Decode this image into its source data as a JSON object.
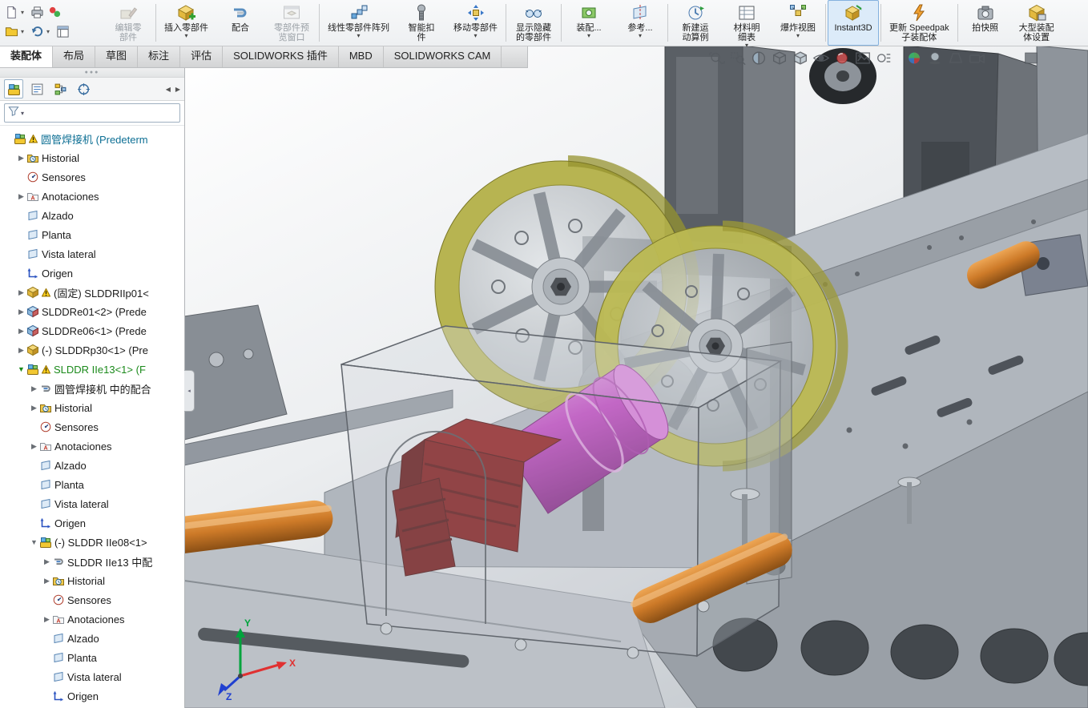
{
  "app": {
    "name": "SOLIDWORKS",
    "document": "圆管焊接机"
  },
  "colors": {
    "accent": "#2d7dc4",
    "selected-green": "#1b8a1b",
    "root-blue": "#0d6f94",
    "olive": "#b3b048",
    "olive-bright": "#bcb952",
    "magenta": "#c143c1",
    "dark-red": "#7d1212",
    "orange": "#cd7a28"
  },
  "quick_access": {
    "row1": [
      {
        "id": "new-document",
        "caret": true
      },
      {
        "id": "print",
        "caret": false
      },
      {
        "id": "performance",
        "caret": false
      }
    ],
    "row2": [
      {
        "id": "open-document",
        "caret": true
      },
      {
        "id": "undo",
        "caret": true
      },
      {
        "id": "task-list",
        "caret": false
      }
    ]
  },
  "command_manager": {
    "buttons": [
      {
        "id": "edit-component",
        "lines": [
          "编辑零",
          "部件"
        ],
        "disabled": true
      },
      {
        "sep": true
      },
      {
        "id": "insert-component",
        "lines": [
          "插入零部件"
        ],
        "dropdown": true
      },
      {
        "id": "mate",
        "lines": [
          "配合"
        ]
      },
      {
        "id": "component-preview",
        "lines": [
          "零部件预",
          "览窗口"
        ],
        "disabled": true
      },
      {
        "sep": true
      },
      {
        "id": "linear-pattern",
        "lines": [
          "线性零部件阵列"
        ],
        "dropdown": true
      },
      {
        "id": "smart-fastener",
        "lines": [
          "智能扣",
          "件"
        ]
      },
      {
        "id": "move-component",
        "lines": [
          "移动零部件"
        ],
        "dropdown": true
      },
      {
        "sep": true
      },
      {
        "id": "show-hidden",
        "lines": [
          "显示隐藏",
          "的零部件"
        ]
      },
      {
        "sep": true
      },
      {
        "id": "assembly-features",
        "lines": [
          "装配..."
        ],
        "dropdown": true
      },
      {
        "id": "reference",
        "lines": [
          "参考..."
        ],
        "dropdown": true
      },
      {
        "sep": true
      },
      {
        "id": "motion-study",
        "lines": [
          "新建运",
          "动算例"
        ]
      },
      {
        "id": "bom",
        "lines": [
          "材料明",
          "细表"
        ],
        "dropdown": true
      },
      {
        "id": "exploded-view",
        "lines": [
          "爆炸视图"
        ],
        "dropdown": true
      },
      {
        "sep": true
      },
      {
        "id": "instant3d",
        "lines": [
          "Instant3D"
        ],
        "active": true
      },
      {
        "sep": true
      },
      {
        "id": "speedpak",
        "lines": [
          "更新 Speedpak",
          "子装配体"
        ]
      },
      {
        "sep": true
      },
      {
        "id": "snapshot",
        "lines": [
          "拍快照"
        ]
      },
      {
        "id": "large-assembly",
        "lines": [
          "大型装配",
          "体设置"
        ]
      }
    ]
  },
  "tabs": [
    {
      "label": "装配体",
      "active": true
    },
    {
      "label": "布局"
    },
    {
      "label": "草图"
    },
    {
      "label": "标注"
    },
    {
      "label": "评估"
    },
    {
      "label": "SOLIDWORKS 插件"
    },
    {
      "label": "MBD"
    },
    {
      "label": "SOLIDWORKS CAM"
    }
  ],
  "feature_panel": {
    "manager_tabs": [
      "featuremanager",
      "propertymanager",
      "configurationmanager",
      "dimxpertmanager"
    ],
    "nav_left": "◀",
    "nav_right": "▶",
    "filter": {
      "value": ""
    },
    "tree": [
      {
        "level": 0,
        "arrow": "",
        "icon": "asm",
        "warn": true,
        "label": "圆管焊接机 (Predeterm",
        "cls": "root"
      },
      {
        "level": 1,
        "arrow": "r",
        "icon": "hist",
        "label": "Historial"
      },
      {
        "level": 1,
        "arrow": "",
        "icon": "sens",
        "label": "Sensores"
      },
      {
        "level": 1,
        "arrow": "r",
        "icon": "anno",
        "label": "Anotaciones"
      },
      {
        "level": 1,
        "arrow": "",
        "icon": "plane",
        "label": "Alzado"
      },
      {
        "level": 1,
        "arrow": "",
        "icon": "plane",
        "label": "Planta"
      },
      {
        "level": 1,
        "arrow": "",
        "icon": "plane",
        "label": "Vista lateral"
      },
      {
        "level": 1,
        "arrow": "",
        "icon": "orig",
        "label": "Origen"
      },
      {
        "level": 1,
        "arrow": "r",
        "icon": "part",
        "warn": true,
        "label": "(固定) SLDDRIIp01<"
      },
      {
        "level": 1,
        "arrow": "r",
        "icon": "part2",
        "label": "SLDDRe01<2> (Prede"
      },
      {
        "level": 1,
        "arrow": "r",
        "icon": "part2",
        "label": "SLDDRe06<1> (Prede"
      },
      {
        "level": 1,
        "arrow": "r",
        "icon": "part",
        "label": "(-) SLDDRp30<1> (Pre"
      },
      {
        "level": 1,
        "arrow": "d",
        "icon": "asm",
        "warn": true,
        "label": "SLDDR IIe13<1> (F",
        "cls": "selected"
      },
      {
        "level": 2,
        "arrow": "r",
        "icon": "mate",
        "label": "圆管焊接机 中的配合"
      },
      {
        "level": 2,
        "arrow": "r",
        "icon": "hist",
        "label": "Historial"
      },
      {
        "level": 2,
        "arrow": "",
        "icon": "sens",
        "label": "Sensores"
      },
      {
        "level": 2,
        "arrow": "r",
        "icon": "anno",
        "label": "Anotaciones"
      },
      {
        "level": 2,
        "arrow": "",
        "icon": "plane",
        "label": "Alzado"
      },
      {
        "level": 2,
        "arrow": "",
        "icon": "plane",
        "label": "Planta"
      },
      {
        "level": 2,
        "arrow": "",
        "icon": "plane",
        "label": "Vista lateral"
      },
      {
        "level": 2,
        "arrow": "",
        "icon": "orig",
        "label": "Origen"
      },
      {
        "level": 2,
        "arrow": "d",
        "icon": "asm",
        "label": "(-) SLDDR IIe08<1>"
      },
      {
        "level": 3,
        "arrow": "r",
        "icon": "mate",
        "label": "SLDDR IIe13 中配"
      },
      {
        "level": 3,
        "arrow": "r",
        "icon": "hist",
        "label": "Historial"
      },
      {
        "level": 3,
        "arrow": "",
        "icon": "sens",
        "label": "Sensores"
      },
      {
        "level": 3,
        "arrow": "r",
        "icon": "anno",
        "label": "Anotaciones"
      },
      {
        "level": 3,
        "arrow": "",
        "icon": "plane",
        "label": "Alzado"
      },
      {
        "level": 3,
        "arrow": "",
        "icon": "plane",
        "label": "Planta"
      },
      {
        "level": 3,
        "arrow": "",
        "icon": "plane",
        "label": "Vista lateral"
      },
      {
        "level": 3,
        "arrow": "",
        "icon": "orig",
        "label": "Origen"
      }
    ]
  },
  "viewport": {
    "heads_up": {
      "group1": [
        "zoom-fit",
        "zoom-area",
        "section-view",
        "view-orientation",
        "display-style",
        "hide-show-items",
        "edit-appearance",
        "apply-scene",
        "view-settings"
      ],
      "group2": [
        "realview",
        "shadows",
        "perspective",
        "camera"
      ],
      "group3": [
        "display-pane"
      ]
    },
    "triad": {
      "x": "X",
      "y": "Y",
      "z": "Z"
    }
  }
}
